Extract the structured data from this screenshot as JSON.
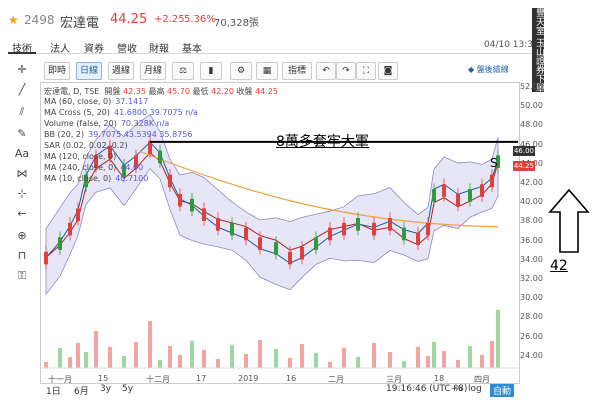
{
  "header": {
    "code": "2498",
    "name": "宏達電",
    "price": "44.25",
    "change": "+2.25",
    "change_pct": "5.36%",
    "volume": "70,328張",
    "tabs": [
      "技術",
      "法人",
      "資券",
      "營收",
      "財報",
      "基本"
    ],
    "datetime": "04/10 13:30"
  },
  "banner": {
    "text": "豐天室 玉山證券下單"
  },
  "toolbar": {
    "buttons": [
      "即時",
      "日線",
      "週線",
      "月線",
      "指標"
    ],
    "icons": [
      "scale-icon",
      "candle-icon",
      "gear-icon",
      "grid-icon",
      "undo-icon",
      "redo-icon",
      "fullscreen-icon",
      "camera-icon"
    ],
    "draw_link": "盤後繪線"
  },
  "legend": {
    "title": "宏達電, D, TSE",
    "ohlc": {
      "open_label": "開盤",
      "open": "42.35",
      "high_label": "最高",
      "high": "45.70",
      "low_label": "最低",
      "low": "42.20",
      "close_label": "收盤",
      "close": "44.25"
    },
    "lines": [
      {
        "label": "MA (60, close, 0)",
        "value": "37.1417"
      },
      {
        "label": "MA Cross (5, 20)",
        "value": "41.6800 39.7075 n/a"
      },
      {
        "label": "Volume (false, 20)",
        "value": "70.328K n/a"
      },
      {
        "label": "BB (20, 2)",
        "value": "39.7075 43.5394 35.8756"
      },
      {
        "label": "SAR (0.02, 0.02, 0.2)",
        "value": ""
      },
      {
        "label": "MA (120, close, 0)",
        "value": ""
      },
      {
        "label": "MA (240, close, 0)",
        "value": "44.00"
      },
      {
        "label": "MA (10, close, 0)",
        "value": "40.7100"
      }
    ]
  },
  "yaxis": {
    "ticks": [
      "52.00",
      "50.00",
      "48.00",
      "46.00",
      "44.00",
      "42.00",
      "40.00",
      "38.00",
      "36.00",
      "34.00",
      "32.00",
      "30.00",
      "28.00",
      "26.00",
      "24.00"
    ],
    "price_tag": "44.25",
    "line_tag": "46.00"
  },
  "xaxis": {
    "ticks": [
      "十一月",
      "15",
      "十二月",
      "17",
      "2019",
      "16",
      "二月",
      "三月",
      "18",
      "四月"
    ]
  },
  "bottom": {
    "ranges": [
      "1日",
      "6月",
      "3y",
      "5y"
    ],
    "clock": "19:16:46 (UTC+8)",
    "pct": "%",
    "log": "log",
    "auto": "自動"
  },
  "annotation": {
    "text": "8萬多套牢大軍",
    "s_label": "S",
    "target": "42"
  },
  "colors": {
    "up": "#e0403b",
    "down": "#2e9a3c",
    "band": "#c9c7ea",
    "accent": "#1f5fa8"
  }
}
